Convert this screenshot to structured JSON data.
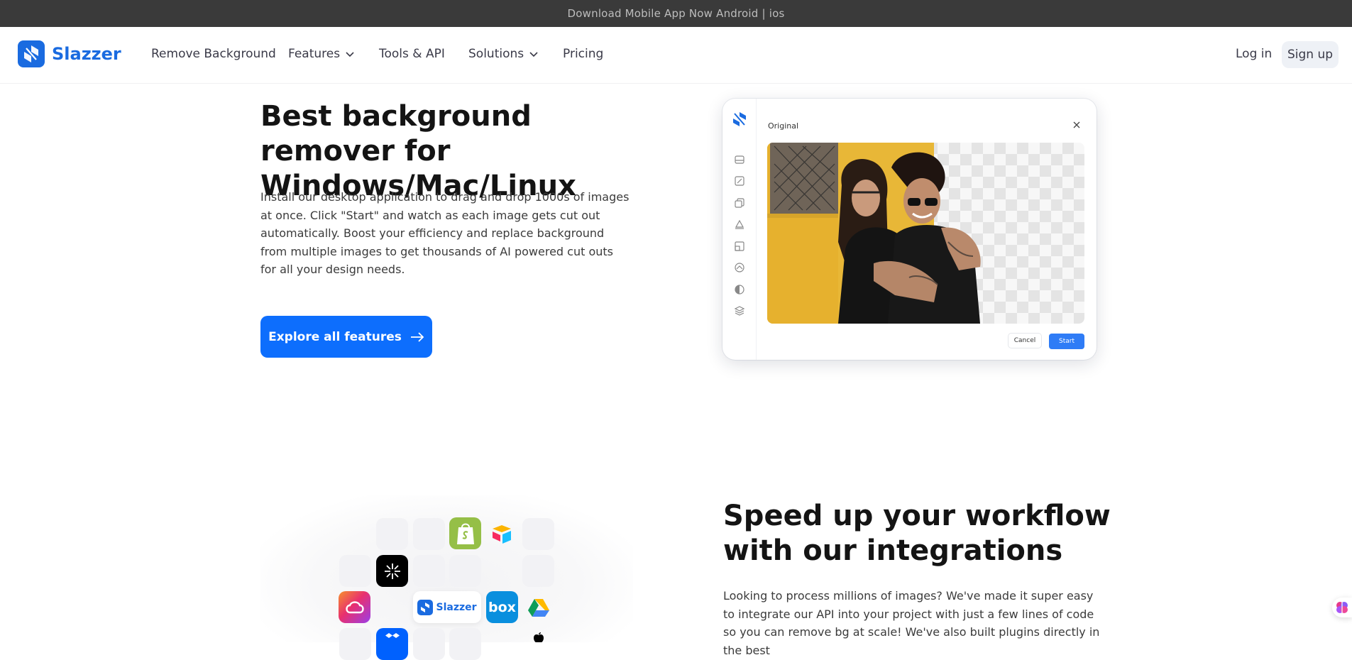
{
  "announcement": {
    "text": "Download Mobile App Now Android | ios"
  },
  "header": {
    "brand": "Slazzer",
    "nav": [
      {
        "label": "Remove Background"
      },
      {
        "label": "Features"
      },
      {
        "label": "Tools & API"
      },
      {
        "label": "Solutions"
      },
      {
        "label": "Pricing"
      }
    ],
    "login_label": "Log in",
    "signup_label": "Sign up"
  },
  "hero": {
    "title": "Best background remover for Windows/Mac/Linux",
    "body": "Install our desktop application to drag and drop 1000s of images at once. Click \"Start\" and watch as each image gets cut out automatically. Boost your efficiency and replace background from multiple images to get thousands of AI powered cut outs for all your design needs.",
    "cta_label": "Explore all features"
  },
  "app_preview": {
    "title": "Original",
    "cancel_label": "Cancel",
    "start_label": "Start"
  },
  "integrations": {
    "title": "Speed up your workflow with our integrations",
    "body": "Looking to process millions of images? We've made it super easy to integrate our API into your project with just a few lines of code so you can remove bg at scale! We've also built plugins directly in the best",
    "center_logo": "Slazzer",
    "box_label": "box"
  },
  "colors": {
    "brand": "#1a6be0",
    "cta": "#0d6efd",
    "topbar": "#3a3a3a"
  }
}
